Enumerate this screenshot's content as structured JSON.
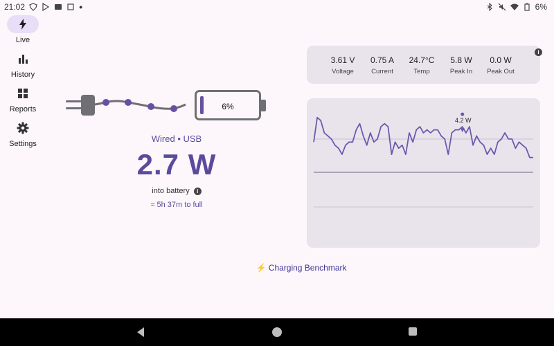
{
  "status_bar": {
    "time": "21:02",
    "battery": "6%"
  },
  "nav": {
    "items": [
      {
        "label": "Live",
        "icon": "bolt-icon",
        "active": true
      },
      {
        "label": "History",
        "icon": "bar-chart-icon",
        "active": false
      },
      {
        "label": "Reports",
        "icon": "grid-icon",
        "active": false
      },
      {
        "label": "Settings",
        "icon": "gear-icon",
        "active": false
      }
    ]
  },
  "charging": {
    "battery_percent_label": "6%",
    "battery_level": 0.06,
    "source": "Wired • USB",
    "power": "2.7 W",
    "power_caption": "into battery",
    "eta": "≈ 5h 37m to full"
  },
  "stats": [
    {
      "value": "3.61 V",
      "label": "Voltage"
    },
    {
      "value": "0.75 A",
      "label": "Current"
    },
    {
      "value": "24.7°C",
      "label": "Temp"
    },
    {
      "value": "5.8 W",
      "label": "Peak In"
    },
    {
      "value": "0.0 W",
      "label": "Peak Out"
    }
  ],
  "chart_data": {
    "type": "line",
    "peak_label": "4.2 W",
    "series": [
      {
        "values": [
          3.3,
          4.1,
          4.0,
          3.6,
          3.5,
          3.4,
          3.2,
          3.1,
          2.9,
          3.2,
          3.3,
          3.3,
          3.7,
          3.9,
          3.5,
          3.2,
          3.6,
          3.3,
          3.4,
          3.8,
          3.9,
          3.8,
          2.9,
          3.3,
          3.1,
          3.2,
          2.9,
          3.6,
          3.3,
          3.7,
          3.8,
          3.6,
          3.7,
          3.6,
          3.7,
          3.7,
          3.5,
          3.4,
          2.9,
          3.6,
          3.7,
          3.7,
          3.8,
          3.6,
          3.8,
          3.2,
          3.5,
          3.3,
          3.2,
          2.9,
          3.1,
          2.9,
          3.3,
          3.4,
          3.6,
          3.4,
          3.4,
          3.1,
          3.3,
          3.2,
          3.1,
          2.8,
          2.8
        ]
      }
    ],
    "peak_index": 42
  },
  "benchmark": {
    "label": "⚡ Charging Benchmark"
  },
  "colors": {
    "accent": "#6750a4",
    "line": "#6a5aad",
    "card": "#e9e4ec"
  }
}
